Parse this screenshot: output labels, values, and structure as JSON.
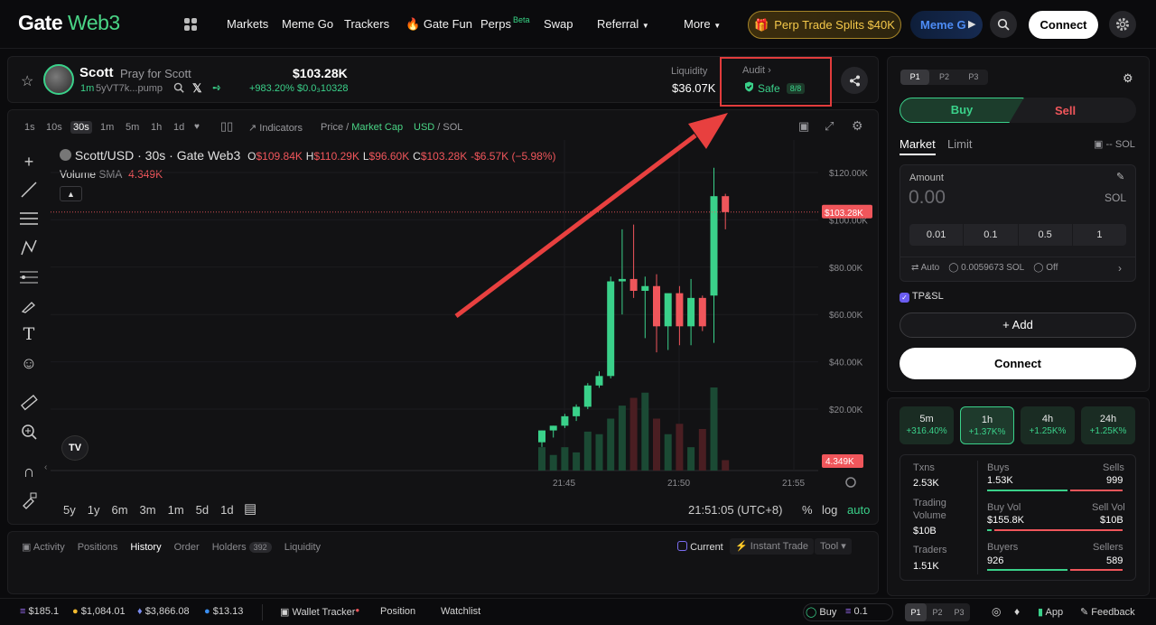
{
  "header": {
    "logo_gate": "Gate",
    "logo_web3": " Web3",
    "nav": [
      "Markets",
      "Meme Go",
      "Trackers",
      "Gate Fun",
      "Perps",
      "Swap",
      "Referral",
      "More"
    ],
    "perps_badge": "Beta",
    "promo": "Perp Trade Splits $40K",
    "meme_button": "Meme G",
    "connect": "Connect"
  },
  "token": {
    "name": "Scott",
    "tagline": "Pray for Scott",
    "age": "1m",
    "address": "5yVT7k...pump",
    "price": "$103.28K",
    "change": "+983.20%",
    "price_sol": "$0.0₃10328",
    "liquidity_label": "Liquidity",
    "liquidity": "$36.07K",
    "audit_label": "Audit",
    "audit_status": "Safe",
    "audit_score": "8/8"
  },
  "chart_toolbar": {
    "timeframes": [
      "1s",
      "10s",
      "30s",
      "1m",
      "5m",
      "1h",
      "1d"
    ],
    "active_tf": "30s",
    "indicators": "Indicators",
    "price_label": "Price",
    "mcap_label": "Market Cap",
    "usd": "USD",
    "sol": "SOL"
  },
  "chart_legend": {
    "symbol": "Scott/USD · 30s · Gate Web3",
    "o_label": "O",
    "o": "$109.84K",
    "h_label": "H",
    "h": "$110.29K",
    "l_label": "L",
    "l": "$96.60K",
    "c_label": "C",
    "c": "$103.28K",
    "chg": "-$6.57K (−5.98%)",
    "volume_label": "Volume",
    "sma_label": "SMA",
    "volume": "4.349K"
  },
  "chart_bottom": {
    "ranges": [
      "5y",
      "1y",
      "6m",
      "3m",
      "1m",
      "5d",
      "1d"
    ],
    "clock": "21:51:05 (UTC+8)",
    "pct": "%",
    "log": "log",
    "auto": "auto"
  },
  "chart_data": {
    "type": "candlestick",
    "y_ticks": [
      "$120.00K",
      "$100.00K",
      "$80.00K",
      "$60.00K",
      "$40.00K",
      "$20.00K"
    ],
    "x_ticks": [
      "21:45",
      "21:50",
      "21:55"
    ],
    "ylim": [
      0,
      125000
    ],
    "last_price_label": "$103.28K",
    "last_volume_label": "4.349K",
    "candles": [
      {
        "o": 6000,
        "h": 11000,
        "l": 4000,
        "c": 11000,
        "v": 0.9
      },
      {
        "o": 11000,
        "h": 13000,
        "l": 8000,
        "c": 13000,
        "v": 0.6
      },
      {
        "o": 13000,
        "h": 18000,
        "l": 12000,
        "c": 17000,
        "v": 0.9
      },
      {
        "o": 17000,
        "h": 22000,
        "l": 15000,
        "c": 21000,
        "v": 0.7
      },
      {
        "o": 21000,
        "h": 31000,
        "l": 20000,
        "c": 30000,
        "v": 1.5
      },
      {
        "o": 30000,
        "h": 36000,
        "l": 29000,
        "c": 34000,
        "v": 1.4
      },
      {
        "o": 34000,
        "h": 76000,
        "l": 33000,
        "c": 74000,
        "v": 2.0
      },
      {
        "o": 74000,
        "h": 96000,
        "l": 60000,
        "c": 75000,
        "v": 2.5
      },
      {
        "o": 75000,
        "h": 98000,
        "l": 67000,
        "c": 70000,
        "v": 2.8
      },
      {
        "o": 70000,
        "h": 76000,
        "l": 50000,
        "c": 72000,
        "v": 3.0
      },
      {
        "o": 72000,
        "h": 77000,
        "l": 44000,
        "c": 55000,
        "v": 2.0
      },
      {
        "o": 55000,
        "h": 64000,
        "l": 45000,
        "c": 69000,
        "v": 1.4
      },
      {
        "o": 69000,
        "h": 72000,
        "l": 47000,
        "c": 55000,
        "v": 1.8
      },
      {
        "o": 55000,
        "h": 75000,
        "l": 47000,
        "c": 67000,
        "v": 0.9
      },
      {
        "o": 67000,
        "h": 68000,
        "l": 53000,
        "c": 55000,
        "v": 1.6
      },
      {
        "o": 68000,
        "h": 125000,
        "l": 48000,
        "c": 110000,
        "v": 3.2
      },
      {
        "o": 110000,
        "h": 111000,
        "l": 96000,
        "c": 103280,
        "v": 0.4
      }
    ]
  },
  "bottom_tabs": [
    "Activity",
    "Positions",
    "History",
    "Order",
    "Holders",
    "Liquidity"
  ],
  "holders_count": "392",
  "bottom_options": {
    "current": "Current",
    "instant": "Instant Trade",
    "tool": "Tool"
  },
  "trade": {
    "pages": [
      "P1",
      "P2",
      "P3"
    ],
    "buy": "Buy",
    "sell": "Sell",
    "market": "Market",
    "limit": "Limit",
    "balance": "-- SOL",
    "amount_label": "Amount",
    "amount": "0.00",
    "unit": "SOL",
    "quick": [
      "0.01",
      "0.1",
      "0.5",
      "1"
    ],
    "auto": "Auto",
    "fee": "0.0059673 SOL",
    "mev": "Off",
    "tpsl": "TP&SL",
    "add": "Add",
    "connect": "Connect"
  },
  "periods": [
    {
      "label": "5m",
      "change": "+316.40%"
    },
    {
      "label": "1h",
      "change": "+1.37K%"
    },
    {
      "label": "4h",
      "change": "+1.25K%"
    },
    {
      "label": "24h",
      "change": "+1.25K%"
    }
  ],
  "stats": {
    "txns_label": "Txns",
    "txns": "2.53K",
    "vol_label": "Trading Volume",
    "vol": "$10B",
    "traders_label": "Traders",
    "traders": "1.51K",
    "buys_label": "Buys",
    "buys": "1.53K",
    "sells_label": "Sells",
    "sells": "999",
    "buyvol_label": "Buy Vol",
    "buyvol": "$155.8K",
    "sellvol_label": "Sell Vol",
    "sellvol": "$10B",
    "buyers_label": "Buyers",
    "buyers": "926",
    "sellers_label": "Sellers",
    "sellers": "589"
  },
  "footer": {
    "p1": "$185.1",
    "p2": "$1,084.01",
    "p3": "$3,866.08",
    "p4": "$13.13",
    "wallet": "Wallet Tracker",
    "position": "Position",
    "watchlist": "Watchlist",
    "buy": "Buy",
    "amount": "0.1",
    "pages": [
      "P1",
      "P2",
      "P3"
    ],
    "app": "App",
    "feedback": "Feedback"
  },
  "colors": {
    "up": "#3ad18a",
    "down": "#f0565b",
    "accent": "#4ad586",
    "annotation": "#e8403f"
  }
}
